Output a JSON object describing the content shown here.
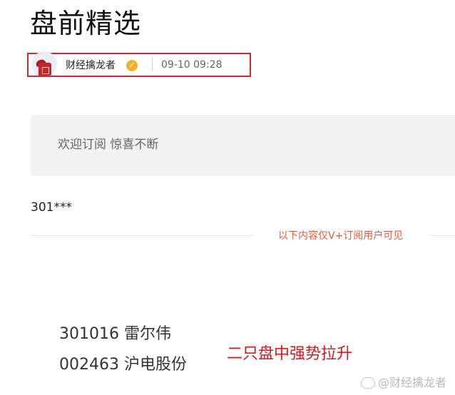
{
  "article": {
    "title": "盘前精选",
    "author": {
      "name": "财经擒龙者",
      "verified_icon": "verified-badge-icon",
      "time": "09-10 09:28"
    },
    "promo_banner": "欢迎订阅 惊喜不断",
    "visible_code": "301***",
    "paywall_note": "以下内容仅V+订阅用户可见",
    "stocks": [
      {
        "line": "301016 雷尔伟"
      },
      {
        "line": "002463 沪电股份"
      }
    ],
    "comment": "二只盘中强势拉升",
    "watermark": "@财经擒龙者"
  },
  "colors": {
    "highlight_box": "#d9262b",
    "paywall_text": "#e35d3d",
    "comment_red": "#e0161b",
    "verified_badge": "#f0b323"
  }
}
